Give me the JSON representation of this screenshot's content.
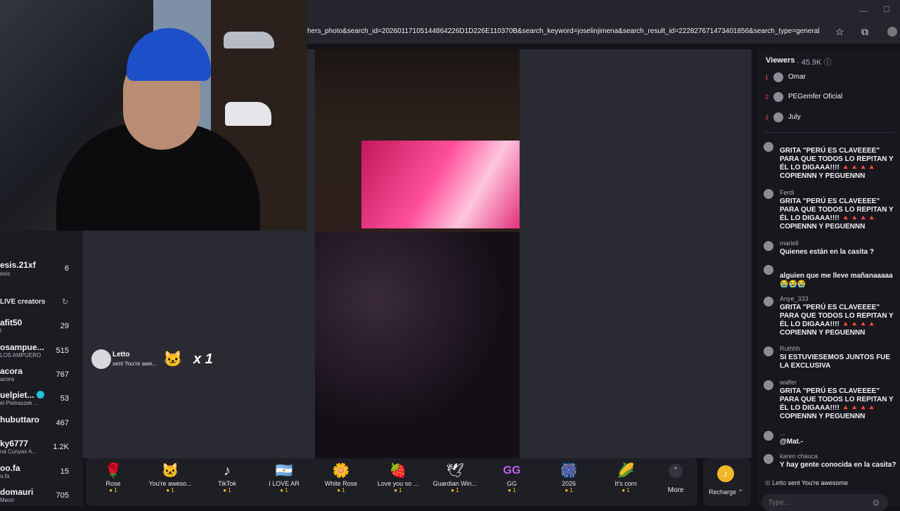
{
  "browser": {
    "url": "hers_photo&search_id=20260117105144864226D1D226E110370B&search_keyword=joselinjimena&search_result_id=222827671473401856&search_type=general",
    "minimize": "—",
    "maximize": "☐",
    "icons": [
      "star-icon",
      "extension-icon",
      "profile-icon"
    ]
  },
  "left_panel": {
    "top_user": {
      "name": "esis.21xf",
      "sub": "esis",
      "count": "6"
    },
    "section_title": "LIVE creators",
    "creators": [
      {
        "name": "afit50",
        "sub": "t",
        "count": "29"
      },
      {
        "name": "osampue...",
        "sub": "LOS AMPUERO",
        "count": "515"
      },
      {
        "name": "acora",
        "sub": "acora",
        "count": "767"
      },
      {
        "name": "uelpiet...",
        "sub": "el Pietraszek ...",
        "count": "53"
      },
      {
        "name": "hubuttaro",
        "sub": "",
        "count": "467"
      },
      {
        "name": "ky6777",
        "sub": "na Cunyas A...",
        "count": "1.2K"
      },
      {
        "name": "oo.fa",
        "sub": "o.fa",
        "count": "15"
      },
      {
        "name": "domauri",
        "sub": "Mauri",
        "count": "705"
      }
    ]
  },
  "gift_notification": {
    "user": "Letto",
    "text": "sent You're awe...",
    "multiplier": "x 1"
  },
  "gifts": [
    {
      "name": "Rose",
      "price": "1",
      "icon": "🌹"
    },
    {
      "name": "You're aweso...",
      "price": "1",
      "icon": "🐱"
    },
    {
      "name": "TikTok",
      "price": "1",
      "icon": "♪"
    },
    {
      "name": "I LOVE AR",
      "price": "1",
      "icon": "🇦🇷"
    },
    {
      "name": "White Rose",
      "price": "1",
      "icon": "🌼"
    },
    {
      "name": "Love you so ...",
      "price": "1",
      "icon": "🍓"
    },
    {
      "name": "Guardian Win...",
      "price": "1",
      "icon": "🕊"
    },
    {
      "name": "GG",
      "price": "1",
      "icon": "GG"
    },
    {
      "name": "2026",
      "price": "1",
      "icon": "🎆"
    },
    {
      "name": "It's corn",
      "price": "1",
      "icon": "🌽"
    }
  ],
  "more_label": "More",
  "recharge_label": "Recharge",
  "viewers": {
    "title": "Viewers",
    "count": "45.9K",
    "top": [
      {
        "rank": "1",
        "name": "Omar"
      },
      {
        "rank": "2",
        "name": "PEGemfer Oficial"
      },
      {
        "rank": "3",
        "name": "July"
      }
    ]
  },
  "chat": [
    {
      "user": "",
      "text": "GRITA \"PERÚ ES CLAVEEEE\" PARA QUE TODOS LO REPITAN Y ÉL LO DIGAAA!!!! 🔺🔺🔺🔺 COPIENNN Y PEGUENNN"
    },
    {
      "user": "Ferdi",
      "text": "GRITA \"PERÚ ES CLAVEEEE\" PARA QUE TODOS LO REPITAN Y ÉL LO DIGAAA!!!! 🔺🔺🔺🔺 COPIENNN Y PEGUENNN"
    },
    {
      "user": "mariell",
      "text": "Quienes están en la casita ?"
    },
    {
      "user": "",
      "text": "alguien que me lleve mañanaaaaa 😭😭😭"
    },
    {
      "user": "Anye_333",
      "text": "GRITA \"PERÚ ES CLAVEEEE\" PARA QUE TODOS LO REPITAN Y ÉL LO DIGAAA!!!! 🔺🔺🔺🔺 COPIENNN Y PEGUENNN"
    },
    {
      "user": "Ruthhh",
      "text": "SI ESTUVIESEMOS JUNTOS FUE LA EXCLUSIVA"
    },
    {
      "user": "walfer",
      "text": "GRITA \"PERÚ ES CLAVEEEE\" PARA QUE TODOS LO REPITAN Y ÉL LO DIGAAA!!!! 🔺🔺🔺🔺 COPIENNN Y PEGUENNN"
    },
    {
      "user": "...",
      "text": "@Mat.-"
    },
    {
      "user": "karen chauca",
      "text": "Y hay gente conocida en la casita?"
    }
  ],
  "chat_footer": {
    "user": "Letto",
    "text": "sent You're awesome"
  },
  "input": {
    "placeholder": "Type..."
  }
}
